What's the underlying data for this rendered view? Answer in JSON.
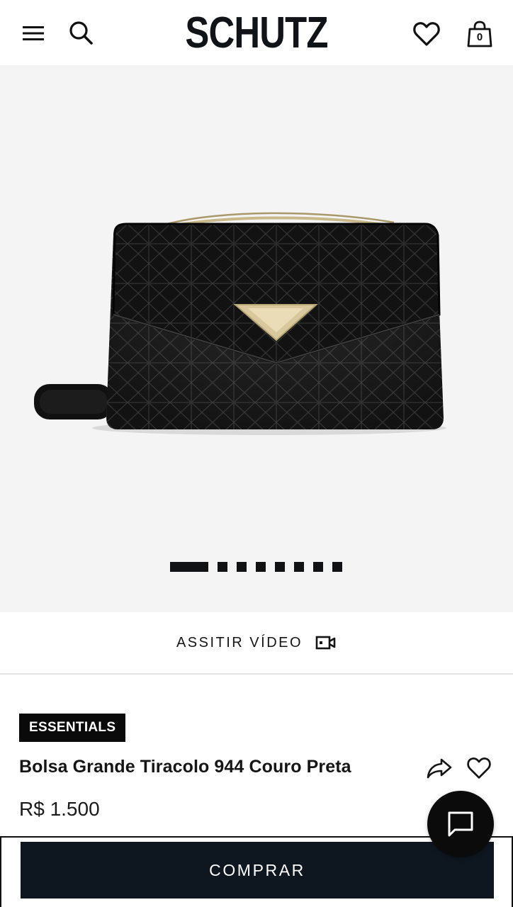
{
  "header": {
    "logo": "SCHUTZ",
    "menu_icon": "hamburger-menu-icon",
    "search_icon": "search-icon",
    "favorites_icon": "heart-icon",
    "bag_icon": "shopping-bag-icon",
    "bag_count": "0"
  },
  "gallery": {
    "image_subject": "black quilted leather crossbody bag with gold chain and triangle clasp",
    "slide_count": 8,
    "active_slide": 1
  },
  "video": {
    "label": "ASSITIR VÍDEO",
    "icon": "video-camera-icon"
  },
  "product": {
    "badge": "ESSENTIALS",
    "name": "Bolsa Grande Tiracolo 944 Couro Preta",
    "price": "R$ 1.500",
    "share_icon": "share-arrow-icon",
    "wishlist_icon": "heart-icon"
  },
  "actions": {
    "buy_label": "COMPRAR",
    "chat_icon": "chat-bubble-icon"
  },
  "colors": {
    "brand_dark": "#0e1620",
    "gallery_bg": "#f4f4f4",
    "badge_bg": "#0a0a0a"
  }
}
